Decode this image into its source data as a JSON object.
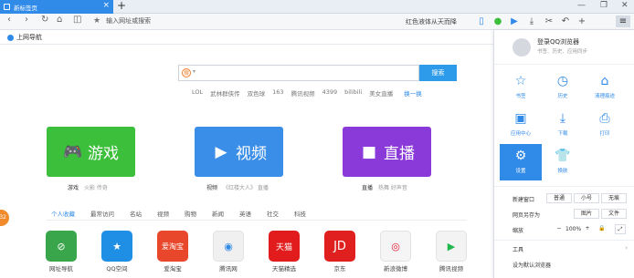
{
  "tab": {
    "title": "新标签页",
    "close": "×",
    "new_tab": "+"
  },
  "window_controls": [
    "—",
    "❐",
    "✕"
  ],
  "nav": {
    "back": "‹",
    "forward": "›",
    "refresh": "↻",
    "home": "⌂",
    "reader": "◫"
  },
  "address": {
    "placeholder": "输入网址或搜索",
    "star": "★"
  },
  "search_hint": "红色液体从天而降",
  "toolbar_icons": [
    "phone-icon",
    "leaf-icon",
    "play-icon",
    "download-icon",
    "scissors-icon",
    "undo-icon",
    "plus-icon",
    "menu-icon"
  ],
  "bookmarks": {
    "item": "上网导航"
  },
  "search": {
    "button": "搜索",
    "engine": "搜"
  },
  "hotwords": [
    "LOL",
    "武林群侠传",
    "双色球",
    "163",
    "腾讯视频",
    "4399",
    "bilibili",
    "美女直播"
  ],
  "hotwords_refresh": "换一换",
  "big_tiles": [
    {
      "title": "游戏",
      "caption": "游戏",
      "sub": "火影  传奇",
      "color": "#3cbf3a"
    },
    {
      "title": "视频",
      "caption": "视频",
      "sub": "《红楼大人》  直播",
      "color": "#3b8ee8"
    },
    {
      "title": "直播",
      "caption": "直播",
      "sub": "热舞  好声音",
      "color": "#8a3ad8"
    }
  ],
  "categories": [
    "个人收藏",
    "最常访问",
    "名站",
    "视频",
    "购物",
    "新闻",
    "英语",
    "社交",
    "科技"
  ],
  "sites": [
    {
      "label": "网址导航",
      "color": "#3aa64b",
      "text": "⊘"
    },
    {
      "label": "QQ空间",
      "color": "#1f8fe5",
      "text": "★"
    },
    {
      "label": "爱淘宝",
      "color": "#e9472b",
      "text": "爱淘宝"
    },
    {
      "label": "腾讯网",
      "color": "#f0f0f0",
      "text": "◉"
    },
    {
      "label": "天猫精选",
      "color": "#e21c1c",
      "text": "天猫"
    },
    {
      "label": "京东",
      "color": "#e0201e",
      "text": "JD"
    },
    {
      "label": "新浪微博",
      "color": "#f5f5f5",
      "text": "◎"
    },
    {
      "label": "腾讯视频",
      "color": "#f3f3f3",
      "text": "▶"
    }
  ],
  "side_bubble": "32",
  "panel": {
    "login": "登录QQ浏览器",
    "login_sub": "书签、历史、应用同步",
    "grid": [
      {
        "label": "书签",
        "icon": "☆"
      },
      {
        "label": "历史",
        "icon": "◷"
      },
      {
        "label": "清理痕迹",
        "icon": "⌂"
      },
      {
        "label": "应用中心",
        "icon": "▣"
      },
      {
        "label": "下载",
        "icon": "⤓"
      },
      {
        "label": "打印",
        "icon": "⎙"
      },
      {
        "label": "设置",
        "icon": "⚙"
      },
      {
        "label": "换肤",
        "icon": "👕"
      }
    ],
    "rows": {
      "new_window": "新建窗口",
      "normal": "普通",
      "small": "小号",
      "no_trace": "无痕",
      "save_as": "网页另存为",
      "image": "图片",
      "file": "文件",
      "zoom": "缩放",
      "zoom_minus": "−",
      "zoom_value": "100%",
      "zoom_plus": "+",
      "tools": "工具",
      "default_browser": "设为默认浏览器"
    }
  }
}
